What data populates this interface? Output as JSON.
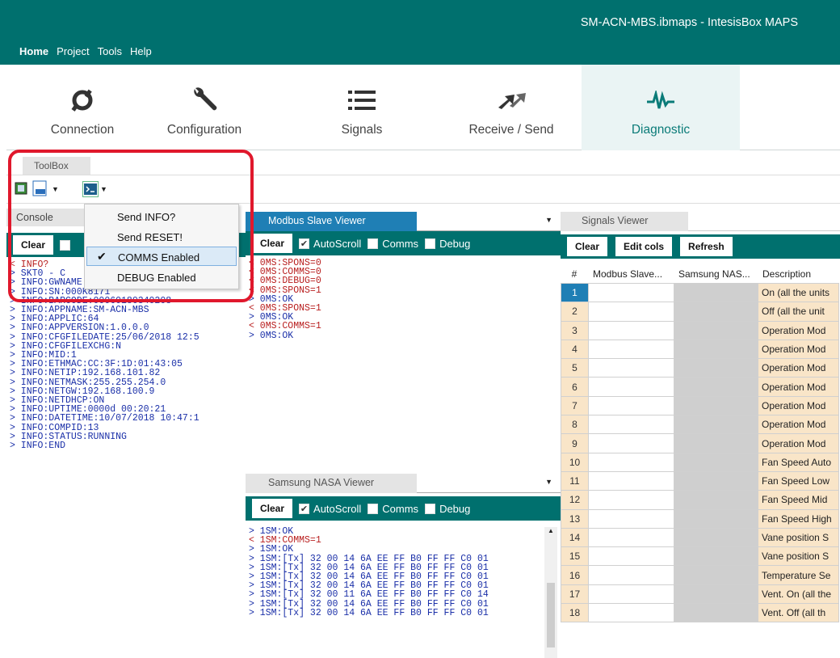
{
  "window": {
    "title": "SM-ACN-MBS.ibmaps - IntesisBox MAPS"
  },
  "menu": [
    "Home",
    "Project",
    "Tools",
    "Help"
  ],
  "ribbon": [
    {
      "label": "Connection",
      "icon": "plug-icon"
    },
    {
      "label": "Configuration",
      "icon": "wrench-icon"
    },
    {
      "label": "Signals",
      "icon": "list-icon"
    },
    {
      "label": "Receive / Send",
      "icon": "transfer-icon"
    },
    {
      "label": "Diagnostic",
      "icon": "pulse-icon"
    }
  ],
  "toolbox": {
    "tab": "ToolBox"
  },
  "dropdown": {
    "items": [
      "Send INFO?",
      "Send RESET!",
      "COMMS Enabled",
      "DEBUG Enabled"
    ],
    "checked": "COMMS Enabled"
  },
  "console": {
    "tab": "Console",
    "clear": "Clear",
    "lines": [
      [
        "out",
        "< INFO?"
      ],
      [
        "in",
        "> SKT0 - C"
      ],
      [
        "in",
        "> INFO:GWNAME:SM-ACN-MBS"
      ],
      [
        "in",
        "> INFO:SN:000K8171"
      ],
      [
        "in",
        "> INFO:BARCODE:00060180340208"
      ],
      [
        "in",
        "> INFO:APPNAME:SM-ACN-MBS"
      ],
      [
        "in",
        "> INFO:APPLIC:64"
      ],
      [
        "in",
        "> INFO:APPVERSION:1.0.0.0"
      ],
      [
        "in",
        "> INFO:CFGFILEDATE:25/06/2018 12:5"
      ],
      [
        "in",
        "> INFO:CFGFILEXCHG:N"
      ],
      [
        "in",
        "> INFO:MID:1"
      ],
      [
        "in",
        "> INFO:ETHMAC:CC:3F:1D:01:43:05"
      ],
      [
        "in",
        "> INFO:NETIP:192.168.101.82"
      ],
      [
        "in",
        "> INFO:NETMASK:255.255.254.0"
      ],
      [
        "in",
        "> INFO:NETGW:192.168.100.9"
      ],
      [
        "in",
        "> INFO:NETDHCP:ON"
      ],
      [
        "in",
        "> INFO:UPTIME:0000d 00:20:21"
      ],
      [
        "in",
        "> INFO:DATETIME:10/07/2018 10:47:1"
      ],
      [
        "in",
        "> INFO:COMPID:13"
      ],
      [
        "in",
        "> INFO:STATUS:RUNNING"
      ],
      [
        "in",
        "> INFO:END"
      ]
    ]
  },
  "modbus": {
    "tab": "Modbus Slave Viewer",
    "clear": "Clear",
    "autoscroll": "AutoScroll",
    "comms": "Comms",
    "debug": "Debug",
    "lines": [
      [
        "out",
        "< 0MS:SPONS=0"
      ],
      [
        "out",
        "< 0MS:COMMS=0"
      ],
      [
        "out",
        "< 0MS:DEBUG=0"
      ],
      [
        "out",
        "< 0MS:SPONS=1"
      ],
      [
        "in",
        "> 0MS:OK"
      ],
      [
        "out",
        "< 0MS:SPONS=1"
      ],
      [
        "in",
        "> 0MS:OK"
      ],
      [
        "out",
        "< 0MS:COMMS=1"
      ],
      [
        "in",
        "> 0MS:OK"
      ]
    ]
  },
  "nasa": {
    "tab": "Samsung NASA Viewer",
    "clear": "Clear",
    "autoscroll": "AutoScroll",
    "comms": "Comms",
    "debug": "Debug",
    "lines": [
      [
        "in",
        "> 1SM:OK"
      ],
      [
        "out",
        "< 1SM:COMMS=1"
      ],
      [
        "in",
        "> 1SM:OK"
      ],
      [
        "in",
        "> 1SM:[Tx] 32 00 14 6A EE FF B0 FF FF C0 01"
      ],
      [
        "in",
        "> 1SM:[Tx] 32 00 14 6A EE FF B0 FF FF C0 01"
      ],
      [
        "in",
        "> 1SM:[Tx] 32 00 14 6A EE FF B0 FF FF C0 01"
      ],
      [
        "in",
        "> 1SM:[Tx] 32 00 14 6A EE FF B0 FF FF C0 01"
      ],
      [
        "in",
        "> 1SM:[Tx] 32 00 11 6A EE FF B0 FF FF C0 14"
      ],
      [
        "in",
        "> 1SM:[Tx] 32 00 14 6A EE FF B0 FF FF C0 01"
      ],
      [
        "in",
        "> 1SM:[Tx] 32 00 14 6A EE FF B0 FF FF C0 01"
      ]
    ]
  },
  "signals": {
    "tab": "Signals Viewer",
    "clear": "Clear",
    "edit_cols": "Edit cols",
    "refresh": "Refresh",
    "columns": [
      "#",
      "Modbus Slave...",
      "Samsung NAS...",
      "Description"
    ],
    "rows": [
      [
        "1",
        "On (all the units"
      ],
      [
        "2",
        "Off (all the unit"
      ],
      [
        "3",
        "Operation Mod"
      ],
      [
        "4",
        "Operation Mod"
      ],
      [
        "5",
        "Operation Mod"
      ],
      [
        "6",
        "Operation Mod"
      ],
      [
        "7",
        "Operation Mod"
      ],
      [
        "8",
        "Operation Mod"
      ],
      [
        "9",
        "Operation Mod"
      ],
      [
        "10",
        "Fan Speed Auto"
      ],
      [
        "11",
        "Fan Speed Low"
      ],
      [
        "12",
        "Fan Speed Mid"
      ],
      [
        "13",
        "Fan Speed High"
      ],
      [
        "14",
        "Vane position S"
      ],
      [
        "15",
        "Vane position S"
      ],
      [
        "16",
        "Temperature Se"
      ],
      [
        "17",
        "Vent. On (all the"
      ],
      [
        "18",
        "Vent. Off (all th"
      ]
    ]
  }
}
